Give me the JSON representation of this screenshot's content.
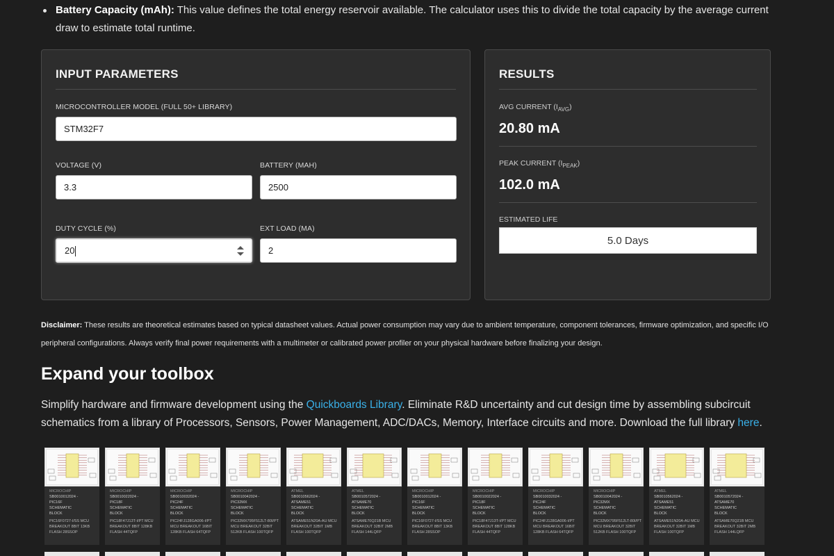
{
  "bullet": {
    "term": "Battery Capacity (mAh):",
    "text": " This value defines the total energy reservoir available. The calculator uses this to divide the total capacity by the average current draw to estimate total runtime."
  },
  "inputs": {
    "title": "INPUT PARAMETERS",
    "mcu_label": "MICROCONTROLLER MODEL (FULL 50+ LIBRARY)",
    "mcu_value": "STM32F7",
    "voltage_label": "VOLTAGE (V)",
    "voltage_value": "3.3",
    "battery_label": "BATTERY (MAH)",
    "battery_value": "2500",
    "duty_label": "DUTY CYCLE (%)",
    "duty_value": "20",
    "load_label": "EXT LOAD (MA)",
    "load_value": "2"
  },
  "results": {
    "title": "RESULTS",
    "avg_label": "AVG CURRENT (I",
    "avg_sub": "AVG",
    "avg_close": ")",
    "avg_value": "20.80 mA",
    "peak_label": "PEAK CURRENT (I",
    "peak_sub": "PEAK",
    "peak_close": ")",
    "peak_value": "102.0 mA",
    "life_label": "ESTIMATED LIFE",
    "life_value": "5.0 Days"
  },
  "disclaimer": {
    "term": "Disclaimer:",
    "text": " These results are theoretical estimates based on typical datasheet values. Actual power consumption may vary due to ambient temperature, component tolerances, firmware optimization, and specific I/O peripheral configurations. Always verify final power requirements with a multimeter or calibrated power profiler on your physical hardware before finalizing your design."
  },
  "toolbox": {
    "heading": "Expand your toolbox",
    "p1": "Simplify hardware and firmware development using the ",
    "link1": "Quickboards Library",
    "p2": ". Eliminate R&D uncertainty and cut design time by assembling subcircuit schematics from a library of Processors, Sensors, Power Management, ADC/DACs, Memory, Interface circuits and more. Download the full library ",
    "link2": "here",
    "p3": "."
  },
  "thumbnails": [
    {
      "mfr": "MICROCHIP",
      "id": "SB0010012024 -",
      "part": "PIC16F",
      "kind": "SCHEMATIC",
      "block": "BLOCK",
      "desc": "PIC16F0727-I/SS MCU BREAKOUT 8BIT 13KB FLASH 28SSOP"
    },
    {
      "mfr": "MICROCHIP",
      "id": "SB0010022024 -",
      "part": "PIC18F",
      "kind": "SCHEMATIC",
      "block": "BLOCK",
      "desc": "PIC18F47J13T-I/PT MCU BREAKOUT 8BIT 128KB FLASH 44TQFP"
    },
    {
      "mfr": "MICROCHIP",
      "id": "SB0010032024 -",
      "part": "PIC24F",
      "kind": "SCHEMATIC",
      "block": "BLOCK",
      "desc": "PIC24FJ128GA006-I/PT MCU BREAKOUT 16BIT 128KB FLASH 64TQFP"
    },
    {
      "mfr": "MICROCHIP",
      "id": "SB0010042024 -",
      "part": "PIC32MX",
      "kind": "SCHEMATIC",
      "block": "BLOCK",
      "desc": "PIC32MX795F512LT-80I/PT MCU BREAKOUT 32BIT 512KB FLASH 100TQFP"
    },
    {
      "mfr": "ATMEL",
      "id": "SB0010562024 -",
      "part": "ATSAME51",
      "kind": "SCHEMATIC",
      "block": "BLOCK",
      "desc": "ATSAME51N20A-AU MCU BREAKOUT 32BIT 1MB FLASH 100TQFP"
    },
    {
      "mfr": "ATMEL",
      "id": "SB0010572024 -",
      "part": "ATSAME70",
      "kind": "SCHEMATIC",
      "block": "BLOCK",
      "desc": "ATSAME70Q21B MCU BREAKOUT 32BIT 2MB FLASH 144LQFP"
    },
    {
      "mfr": "MICROCHIP",
      "id": "SB0010012024 -",
      "part": "PIC16F",
      "kind": "SCHEMATIC",
      "block": "BLOCK",
      "desc": "PIC16F0727-I/SS MCU BREAKOUT 8BIT 13KB FLASH 28SSOP"
    },
    {
      "mfr": "MICROCHIP",
      "id": "SB0010022024 -",
      "part": "PIC18F",
      "kind": "SCHEMATIC",
      "block": "BLOCK",
      "desc": "PIC18F47J13T-I/PT MCU BREAKOUT 8BIT 128KB FLASH 44TQFP"
    },
    {
      "mfr": "MICROCHIP",
      "id": "SB0010032024 -",
      "part": "PIC24F",
      "kind": "SCHEMATIC",
      "block": "BLOCK",
      "desc": "PIC24FJ128GA006-I/PT MCU BREAKOUT 16BIT 128KB FLASH 64TQFP"
    },
    {
      "mfr": "MICROCHIP",
      "id": "SB0010042024 -",
      "part": "PIC32MX",
      "kind": "SCHEMATIC",
      "block": "BLOCK",
      "desc": "PIC32MX795F512LT-80I/PT MCU BREAKOUT 32BIT 512KB FLASH 100TQFP"
    },
    {
      "mfr": "ATMEL",
      "id": "SB0010562024 -",
      "part": "ATSAME51",
      "kind": "SCHEMATIC",
      "block": "BLOCK",
      "desc": "ATSAME51N20A-AU MCU BREAKOUT 32BIT 1MB FLASH 100TQFP"
    },
    {
      "mfr": "ATMEL",
      "id": "SB0010572024 -",
      "part": "ATSAME70",
      "kind": "SCHEMATIC",
      "block": "BLOCK",
      "desc": "ATSAME70Q21B MCU BREAKOUT 32BIT 2MB FLASH 144LQFP"
    }
  ],
  "colors": {
    "page_bg": "#1e1e1e",
    "card_bg": "#2d2d2d",
    "link": "#3ab0e8"
  }
}
